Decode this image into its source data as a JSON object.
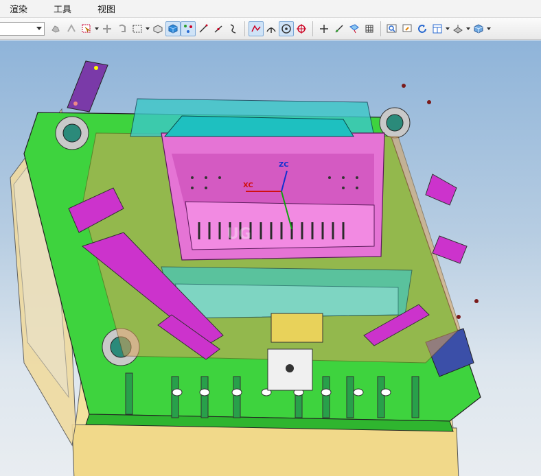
{
  "menu": {
    "items": [
      {
        "label": "渲染"
      },
      {
        "label": "工具"
      },
      {
        "label": "视图"
      }
    ]
  },
  "toolbar": {
    "selection_filter_value": "",
    "icons": [
      "part-navigator-icon",
      "snap-icon",
      "select-filter-icon",
      "move-icon",
      "rotate-icon",
      "box-select-icon",
      "shaded-edges-icon",
      "shaded-solid-icon",
      "vertex-snap-icon",
      "line-icon",
      "line-angle-icon",
      "curve-icon",
      "polyline-icon",
      "arc-icon",
      "circle-center-icon",
      "target-icon",
      "plus-icon",
      "slash-icon",
      "surface-icon",
      "grid-icon",
      "zoom-fit-icon",
      "view-window-icon",
      "refresh-icon",
      "layout-icon",
      "render-style-icon",
      "cube-view-icon"
    ]
  },
  "viewport": {
    "axes": {
      "x": "XC",
      "z": "ZC"
    },
    "watermark": "UG"
  },
  "colors": {
    "mold_plate": "#3ed33e",
    "base_plate": "#f1d98a",
    "cavity": "#e574d5",
    "slider": "#cc33cc",
    "cooling": "#3cc8c8",
    "frame": "#7a3aa8",
    "ejector": "#28a04a",
    "leader_pin": "#2b8a7a"
  }
}
